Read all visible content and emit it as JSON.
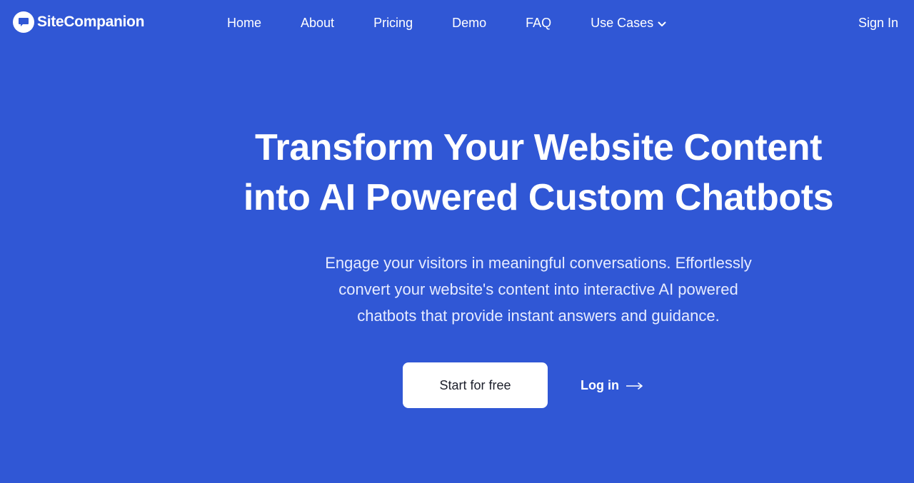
{
  "brand": {
    "name": "SiteCompanion",
    "logo_icon": "chat-bubble-icon"
  },
  "nav": {
    "items": [
      {
        "label": "Home"
      },
      {
        "label": "About"
      },
      {
        "label": "Pricing"
      },
      {
        "label": "Demo"
      },
      {
        "label": "FAQ"
      },
      {
        "label": "Use Cases",
        "icon": "chevron-down-icon"
      }
    ],
    "sign_in_label": "Sign In"
  },
  "hero": {
    "title_line1": "Transform Your Website Content",
    "title_line2": "into AI Powered Custom Chatbots",
    "subtitle_line1": "Engage your visitors in meaningful conversations. Effortlessly",
    "subtitle_line2": "convert your website's content into interactive AI powered",
    "subtitle_line3": "chatbots that provide instant answers and guidance.",
    "primary_cta": "Start for free",
    "secondary_cta": "Log in",
    "secondary_icon": "arrow-right-icon"
  },
  "colors": {
    "background": "#3057d5",
    "text": "#ffffff",
    "button_bg": "#ffffff",
    "button_text": "#1c1f2b"
  }
}
